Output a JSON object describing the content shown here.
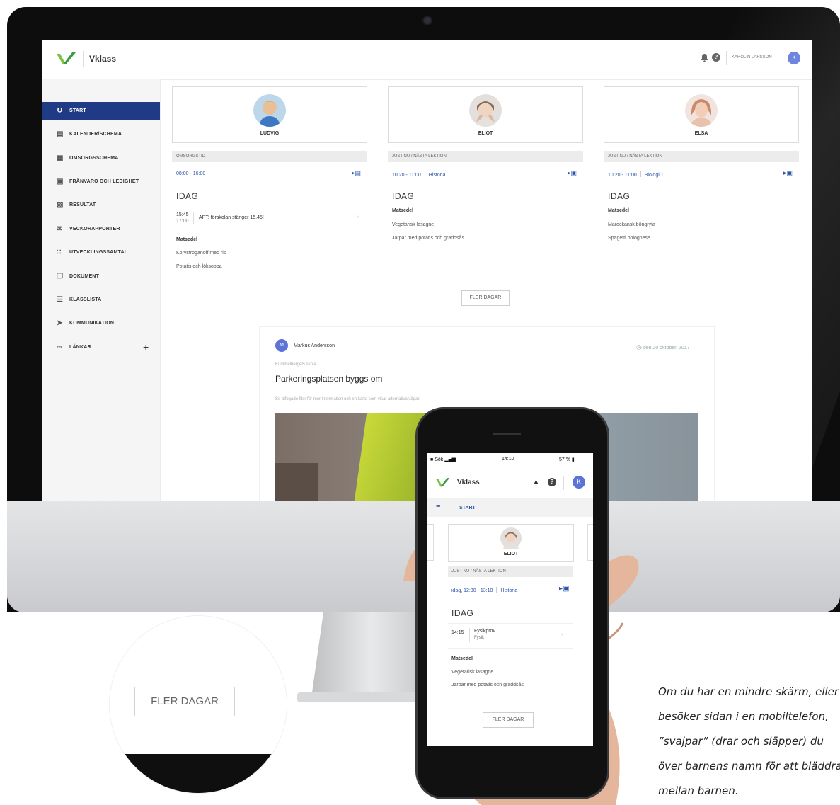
{
  "app": {
    "name": "Vklass",
    "user_name": "KAROLIN LARSSON",
    "user_initial": "K"
  },
  "sidebar": {
    "items": [
      {
        "label": "START",
        "icon": "start-icon",
        "active": true
      },
      {
        "label": "KALENDER/SCHEMA",
        "icon": "calendar-icon"
      },
      {
        "label": "OMSORGSSCHEMA",
        "icon": "calendar-care-icon"
      },
      {
        "label": "FRÅNVARO OCH LEDIGHET",
        "icon": "absence-icon"
      },
      {
        "label": "RESULTAT",
        "icon": "results-icon"
      },
      {
        "label": "VECKORAPPORTER",
        "icon": "mail-icon"
      },
      {
        "label": "UTVECKLINGSSAMTAL",
        "icon": "people-icon"
      },
      {
        "label": "DOKUMENT",
        "icon": "document-icon"
      },
      {
        "label": "KLASSLISTA",
        "icon": "list-icon"
      },
      {
        "label": "KOMMUNIKATION",
        "icon": "send-icon"
      },
      {
        "label": "LÄNKAR",
        "icon": "link-icon",
        "expand": "+"
      }
    ]
  },
  "children": [
    {
      "name": "LUDVIG",
      "section": "OMSORGSTID",
      "time": "08:00 - 16:00",
      "subject": "",
      "today": "IDAG",
      "event_time_start": "15:45",
      "event_time_end": "17:00",
      "event_text": "APT: förskolan stänger 15.45!",
      "menu_title": "Matsedel",
      "menu": [
        "Korvstroganoff med ris",
        "Potatis och löksoppa"
      ]
    },
    {
      "name": "ELIOT",
      "section": "JUST NU / NÄSTA LEKTION",
      "time": "10:20 - 11:00",
      "subject": "Historia",
      "today": "IDAG",
      "menu_title": "Matsedel",
      "menu": [
        "Vegetarisk lasagne",
        "Järpar med potatis och gräddsås"
      ]
    },
    {
      "name": "ELSA",
      "section": "JUST NU / NÄSTA LEKTION",
      "time": "10:20 - 11:00",
      "subject": "Biologi 1",
      "today": "IDAG",
      "menu_title": "Matsedel",
      "menu": [
        "Marockansk böngryta",
        "Spagetti bolognese"
      ]
    }
  ],
  "more_days_label": "FLER DAGAR",
  "news": {
    "author_initial": "M",
    "author": "Markus Andersson",
    "date": "den 20 oktober, 2017",
    "school": "Kummelbergets skola",
    "title": "Parkeringsplatsen byggs om",
    "description": "Se bifogade filer för mer information och en karta som visar alternativa vägar."
  },
  "magnifier": {
    "label": "FLER DAGAR"
  },
  "phone": {
    "status_carrier": "Sök",
    "status_time": "14:10",
    "status_battery": "57 %",
    "brand": "Vklass",
    "user_initial": "K",
    "nav_label": "START",
    "child_name": "ELIOT",
    "section": "JUST NU / NÄSTA LEKTION",
    "time": "idag, 12:30 - 13:10",
    "subject": "Historia",
    "today": "IDAG",
    "event_time": "14:15",
    "event_title": "Fysikprov",
    "event_subject": "Fysik",
    "menu_title": "Matsedel",
    "menu": [
      "Vegetarisk lasagne",
      "Järpar med potatis och gräddsås"
    ],
    "more_days_label": "FLER DAGAR"
  },
  "caption": {
    "lines": [
      "Om du har en mindre skärm, eller",
      "besöker sidan i en mobiltelefon,",
      "”svajpar” (drar och släpper) du",
      "över barnens namn för att bläddra",
      "mellan barnen."
    ]
  },
  "colors": {
    "primary": "#1f3b86",
    "link": "#2b54a8",
    "brand_green": "#4caf50",
    "avatar": "#5d73d6"
  }
}
